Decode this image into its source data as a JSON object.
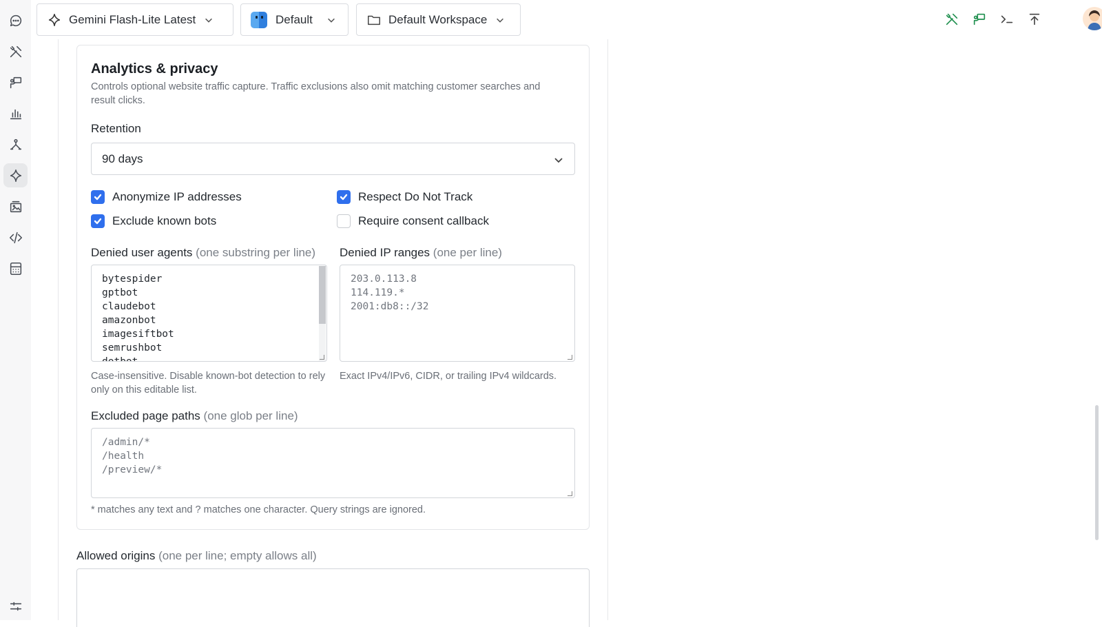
{
  "topbar": {
    "model_label": "Gemini Flash-Lite Latest",
    "profile_label": "Default",
    "workspace_label": "Default Workspace"
  },
  "sidebar": {
    "items": [
      {
        "icon": "chat-icon"
      },
      {
        "icon": "tools-icon"
      },
      {
        "icon": "presentation-icon"
      },
      {
        "icon": "bar-chart-icon"
      },
      {
        "icon": "vector-pen-icon"
      },
      {
        "icon": "sparkle-icon",
        "active": true
      },
      {
        "icon": "image-gallery-icon"
      },
      {
        "icon": "code-icon"
      },
      {
        "icon": "calculator-icon"
      },
      {
        "icon": "sliders-icon"
      }
    ]
  },
  "analytics": {
    "title": "Analytics & privacy",
    "description": "Controls optional website traffic capture. Traffic exclusions also omit matching customer searches and result clicks.",
    "retention_label": "Retention",
    "retention_value": "90 days",
    "checkboxes": {
      "anonymize_ip": {
        "label": "Anonymize IP addresses",
        "checked": true
      },
      "respect_dnt": {
        "label": "Respect Do Not Track",
        "checked": true
      },
      "exclude_bots": {
        "label": "Exclude known bots",
        "checked": true
      },
      "require_consent": {
        "label": "Require consent callback",
        "checked": false
      }
    },
    "denied_agents": {
      "label": "Denied user agents",
      "hint": "(one substring per line)",
      "value": "bytespider\ngptbot\nclaudebot\namazonbot\nimagesiftbot\nsemrushbot\ndotbot",
      "note": "Case-insensitive. Disable known-bot detection to rely only on this editable list."
    },
    "denied_ips": {
      "label": "Denied IP ranges",
      "hint": "(one per line)",
      "placeholder": "203.0.113.8\n114.119.*\n2001:db8::/32",
      "note": "Exact IPv4/IPv6, CIDR, or trailing IPv4 wildcards."
    },
    "excluded_paths": {
      "label": "Excluded page paths",
      "hint": "(one glob per line)",
      "placeholder": "/admin/*\n/health\n/preview/*",
      "note": "* matches any text and ? matches one character. Query strings are ignored."
    }
  },
  "allowed_origins": {
    "label": "Allowed origins",
    "hint": "(one per line; empty allows all)",
    "value": ""
  },
  "colors": {
    "accent_blue": "#2f6fed",
    "toolbar_green": "#1f8f4e"
  }
}
